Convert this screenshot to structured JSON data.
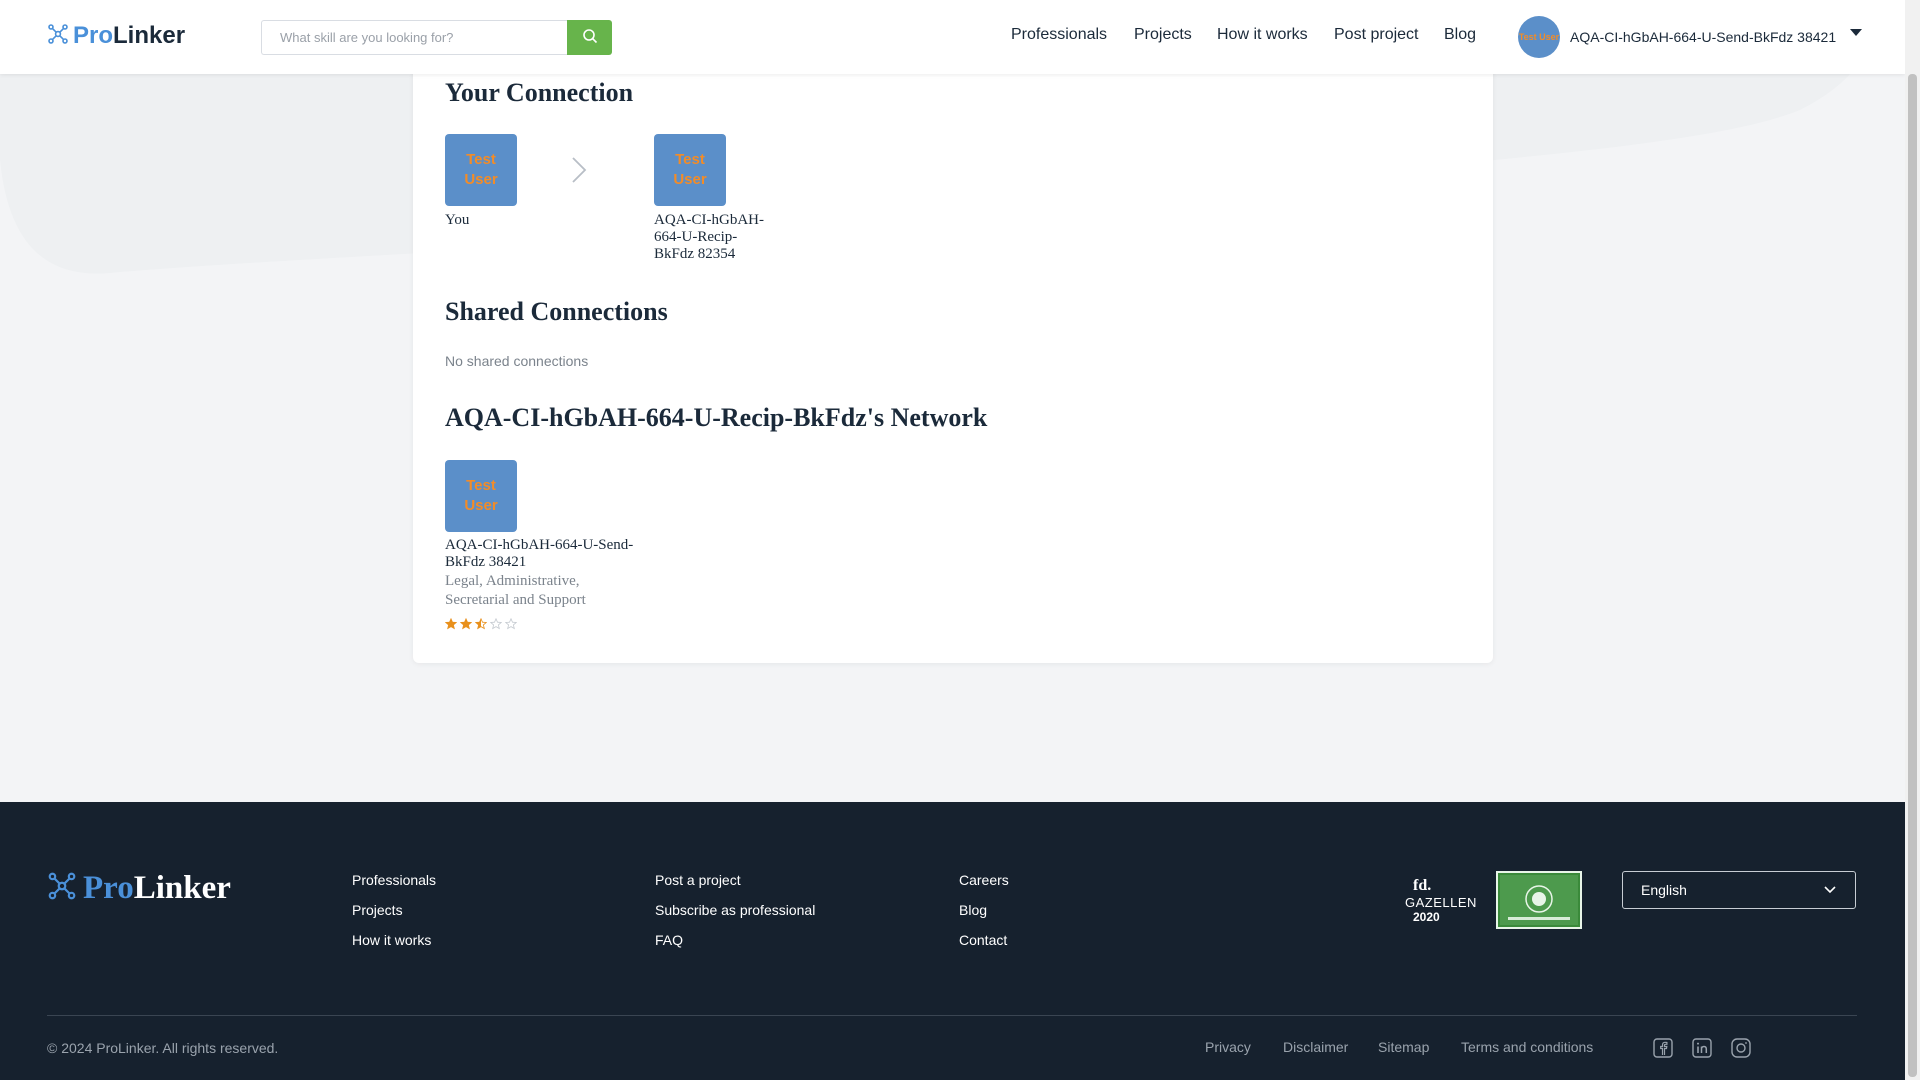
{
  "header": {
    "logo": {
      "pro": "Pro",
      "linker": "Linker"
    },
    "search": {
      "placeholder": "What skill are you looking for?"
    },
    "nav": [
      "Professionals",
      "Projects",
      "How it works",
      "Post project",
      "Blog"
    ],
    "user": {
      "avatar_text": "Test User",
      "name": "AQA-CI-hGbAH-664-U-Send-BkFdz 38421"
    }
  },
  "connection": {
    "title": "Your Connection",
    "you": {
      "avatar_text_line1": "Test",
      "avatar_text_line2": "User",
      "label": "You"
    },
    "target": {
      "avatar_text_line1": "Test",
      "avatar_text_line2": "User",
      "label": "AQA-CI-hGbAH-664-U-Recip-BkFdz 82354"
    }
  },
  "shared": {
    "title": "Shared Connections",
    "empty_text": "No shared connections"
  },
  "network": {
    "title": "AQA-CI-hGbAH-664-U-Recip-BkFdz's Network",
    "members": [
      {
        "avatar_text_line1": "Test",
        "avatar_text_line2": "User",
        "name": "AQA-CI-hGbAH-664-U-Send-BkFdz 38421",
        "category": "Legal, Administrative, Secretarial and Support",
        "rating": 2.5,
        "rating_max": 5
      }
    ]
  },
  "footer": {
    "logo": {
      "pro": "Pro",
      "linker": "Linker"
    },
    "col1": [
      "Professionals",
      "Projects",
      "How it works"
    ],
    "col2": [
      "Post a project",
      "Subscribe as professional",
      "FAQ"
    ],
    "col3": [
      "Careers",
      "Blog",
      "Contact"
    ],
    "badge_gazellen": {
      "fd": "fd.",
      "name": "GAZELLEN",
      "year": "2020"
    },
    "language": "English",
    "copyright": "© 2024 ProLinker. All rights reserved.",
    "legal": [
      "Privacy",
      "Disclaimer",
      "Sitemap",
      "Terms and conditions"
    ],
    "social_icons": [
      "facebook-icon",
      "linkedin-icon",
      "instagram-icon"
    ]
  },
  "colors": {
    "brand_blue": "#4a90d9",
    "brand_green": "#67b44b",
    "avatar_bg": "#5b8fc9",
    "avatar_text": "#f28c28",
    "footer_bg": "#16212e",
    "star": "#e8901c"
  }
}
